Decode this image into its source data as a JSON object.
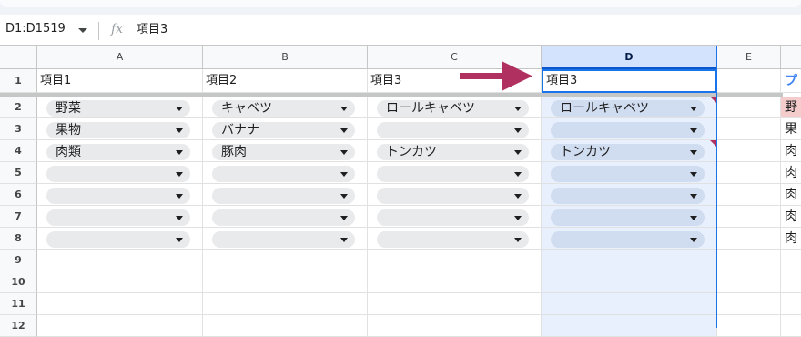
{
  "formula_bar": {
    "name_box": "D1:D1519",
    "fx_icon": "fx-icon",
    "content": "項目3"
  },
  "columns": [
    "A",
    "B",
    "C",
    "D",
    "E"
  ],
  "rows": [
    "1",
    "2",
    "3",
    "4",
    "5",
    "6",
    "7",
    "8",
    "9",
    "10",
    "11",
    "12"
  ],
  "headers": [
    "項目1",
    "項目2",
    "項目3",
    "項目3"
  ],
  "data": [
    [
      "野菜",
      "キャベツ",
      "ロールキャベツ",
      "ロールキャベツ"
    ],
    [
      "果物",
      "バナナ",
      "",
      ""
    ],
    [
      "肉類",
      "豚肉",
      "トンカツ",
      "トンカツ"
    ],
    [
      "",
      "",
      "",
      ""
    ],
    [
      "",
      "",
      "",
      ""
    ],
    [
      "",
      "",
      "",
      ""
    ],
    [
      "",
      "",
      "",
      ""
    ]
  ],
  "right_column": {
    "header": "プ",
    "values": [
      "野",
      "果",
      "肉",
      "肉",
      "肉",
      "肉",
      "肉"
    ]
  },
  "colors": {
    "selection": "#d3e3fd",
    "accent": "#1a73e8",
    "arrow": "#b0305f",
    "chip": "#e9eaec"
  }
}
